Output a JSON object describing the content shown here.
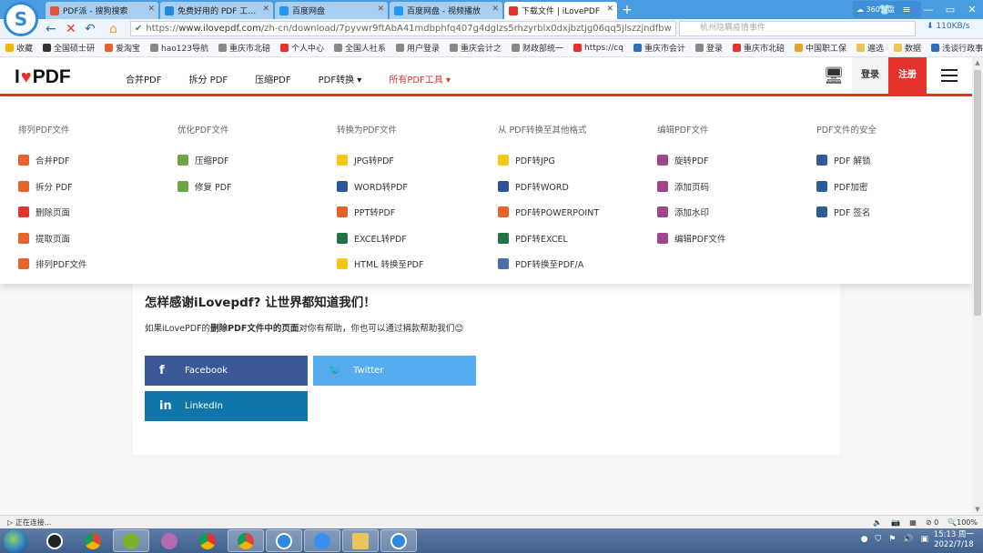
{
  "browser": {
    "tabs": [
      {
        "label": "PDF派 - 搜狗搜索",
        "color": "#e8543a"
      },
      {
        "label": "免费好用的 PDF 工具---",
        "color": "#1e88e5"
      },
      {
        "label": "百度网盘",
        "color": "#2196f3"
      },
      {
        "label": "百度网盘 - 视频播放",
        "color": "#2196f3"
      },
      {
        "label": "下载文件 | iLovePDF",
        "color": "#e5322d"
      }
    ],
    "new_tab": "+",
    "url_prefix": "https://",
    "url_host": "www.ilovepdf.com",
    "url_path": "/zh-cn/download/7pyvwr9ftAbA41mdbphfq407g4dglzs5rhzyrblx0dxjbztjg06qq5jlszzjndfbw",
    "search_placeholder": "杭州隐瞒疫情事件",
    "cloud_label": "360云盘",
    "speed": "110KB/s",
    "bookmarks": [
      "收藏",
      "全国硕士研",
      "爱淘宝",
      "hao123导航",
      "重庆市北碚",
      "个人中心",
      "全国人社系",
      "用户登录",
      "重庆会计之",
      "财政部统一",
      "https://cq",
      "重庆市会计",
      "登录",
      "重庆市北碚",
      "中国职工保",
      "遍选",
      "数据",
      "浅谈行政事"
    ]
  },
  "site": {
    "brand_left": "I",
    "brand_right": "PDF",
    "nav": [
      "合并PDF",
      "拆分 PDF",
      "压缩PDF",
      "PDF转换 ▾",
      "所有PDF工具 ▾"
    ],
    "login": "登录",
    "register": "注册",
    "accent": "#e5322d"
  },
  "mega_menu": [
    {
      "heading": "排列PDF文件",
      "items": [
        {
          "label": "合并PDF",
          "color": "#e5632d"
        },
        {
          "label": "拆分 PDF",
          "color": "#e5632d"
        },
        {
          "label": "删除页面",
          "color": "#e5322d"
        },
        {
          "label": "提取页面",
          "color": "#e5632d"
        },
        {
          "label": "排列PDF文件",
          "color": "#e5632d"
        }
      ]
    },
    {
      "heading": "优化PDF文件",
      "items": [
        {
          "label": "压缩PDF",
          "color": "#6da542"
        },
        {
          "label": "修复 PDF",
          "color": "#6da542"
        }
      ]
    },
    {
      "heading": "转换为PDF文件",
      "items": [
        {
          "label": "JPG转PDF",
          "color": "#f5c518"
        },
        {
          "label": "WORD转PDF",
          "color": "#2b579a"
        },
        {
          "label": "PPT转PDF",
          "color": "#e5632d"
        },
        {
          "label": "EXCEL转PDF",
          "color": "#217346"
        },
        {
          "label": "HTML 转换至PDF",
          "color": "#f5c518"
        }
      ]
    },
    {
      "heading": "从 PDF转换至其他格式",
      "items": [
        {
          "label": "PDF转JPG",
          "color": "#f5c518"
        },
        {
          "label": "PDF转WORD",
          "color": "#2b579a"
        },
        {
          "label": "PDF转POWERPOINT",
          "color": "#e5632d"
        },
        {
          "label": "PDF转EXCEL",
          "color": "#217346"
        },
        {
          "label": "PDF转换至PDF/A",
          "color": "#4a6fa5"
        }
      ]
    },
    {
      "heading": "编辑PDF文件",
      "items": [
        {
          "label": "旋转PDF",
          "color": "#a0458b"
        },
        {
          "label": "添加页码",
          "color": "#a0458b"
        },
        {
          "label": "添加水印",
          "color": "#a0458b"
        },
        {
          "label": "编辑PDF文件",
          "color": "#a0458b"
        }
      ]
    },
    {
      "heading": "PDF文件的安全",
      "items": [
        {
          "label": "PDF 解锁",
          "color": "#2e5c9a"
        },
        {
          "label": "PDF加密",
          "color": "#2e5c9a"
        },
        {
          "label": "PDF 签名",
          "color": "#2e5c9a"
        }
      ]
    }
  ],
  "content": {
    "thanks_title": "怎样感谢iLovepdf? 让世界都知道我们！",
    "desc_pre": "如果iLovePDF的",
    "desc_bold": "删除PDF文件中的页面",
    "desc_post": "对你有帮助，你也可以通过捐款帮助我们😊",
    "facebook": "Facebook",
    "twitter": "Twitter",
    "linkedin": "LinkedIn"
  },
  "status": {
    "text": "正在连接...",
    "zoom": "100%",
    "count": "0"
  },
  "taskbar": {
    "time": "15:13 周一",
    "date": "2022/7/18"
  }
}
